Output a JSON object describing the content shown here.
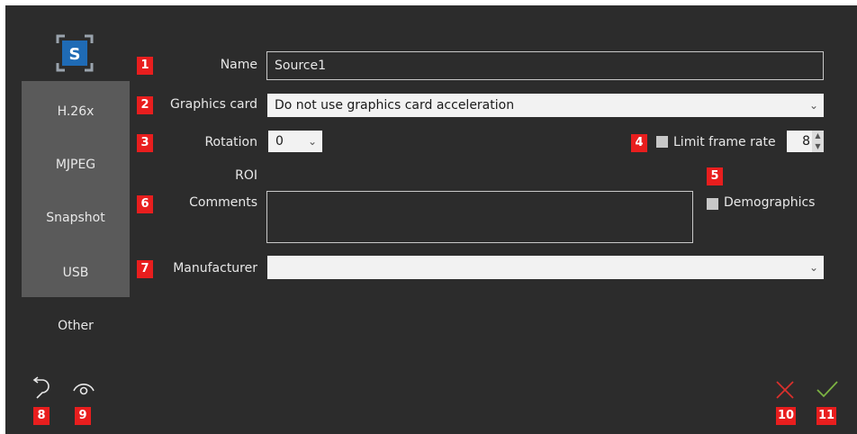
{
  "logo": {
    "letter": "S"
  },
  "sidebar": {
    "items": [
      {
        "label": "H.26x"
      },
      {
        "label": "MJPEG"
      },
      {
        "label": "Snapshot"
      },
      {
        "label": "USB"
      },
      {
        "label": "Other"
      }
    ]
  },
  "form": {
    "name_label": "Name",
    "name_value": "Source1",
    "graphics_label": "Graphics card",
    "graphics_value": "Do not use graphics card acceleration",
    "rotation_label": "Rotation",
    "rotation_value": "0",
    "limit_label": "Limit frame rate",
    "limit_value": "8",
    "roi_label": "ROI",
    "comments_label": "Comments",
    "comments_value": "",
    "demographics_label": "Demographics",
    "manufacturer_label": "Manufacturer",
    "manufacturer_value": ""
  },
  "badges": [
    "1",
    "2",
    "3",
    "4",
    "5",
    "6",
    "7",
    "8",
    "9",
    "10",
    "11"
  ],
  "colors": {
    "background": "#2c2c2c",
    "sidebar": "#5a5a5a",
    "accent": "#1f6bb5",
    "badge": "#e81e1e",
    "cancel": "#d9302c",
    "confirm": "#7cb342"
  },
  "icons": {
    "undo": "undo-icon",
    "preview": "eye-icon",
    "cancel": "close-icon",
    "confirm": "check-icon"
  }
}
